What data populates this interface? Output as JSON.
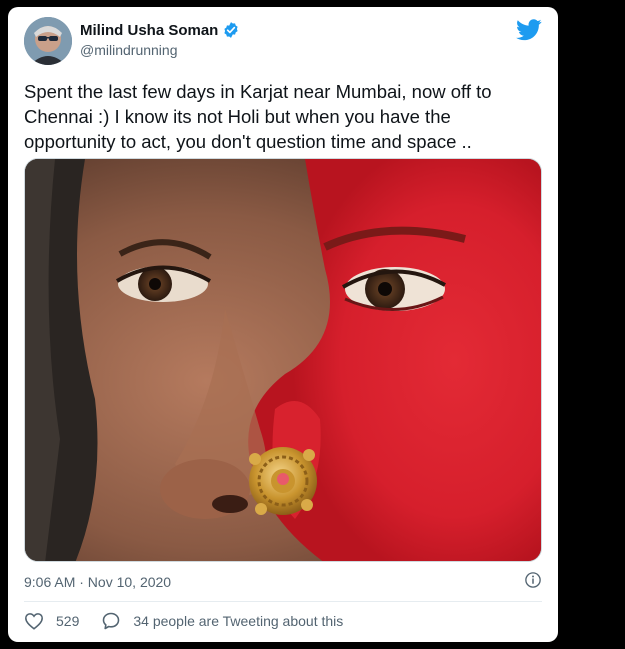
{
  "tweet": {
    "author_name": "Milind Usha Soman",
    "handle": "@milindrunning",
    "text_lines": [
      "Spent the last few days in Karjat near Mumbai, now off to",
      "Chennai :) I know its not Holi but when you have the",
      "opportunity to act, you don't question time and space .."
    ],
    "timestamp": "9:06 AM · Nov 10, 2020",
    "like_count": "529",
    "activity_text": "34 people are Tweeting about this"
  },
  "icons": {
    "logo": "twitter-bird-icon",
    "verified": "verified-badge-icon",
    "info": "info-icon",
    "like": "heart-icon",
    "reply": "speech-bubble-icon"
  },
  "colors": {
    "twitter_blue": "#1d9bf0",
    "text": "#0f1419",
    "secondary": "#536471"
  }
}
